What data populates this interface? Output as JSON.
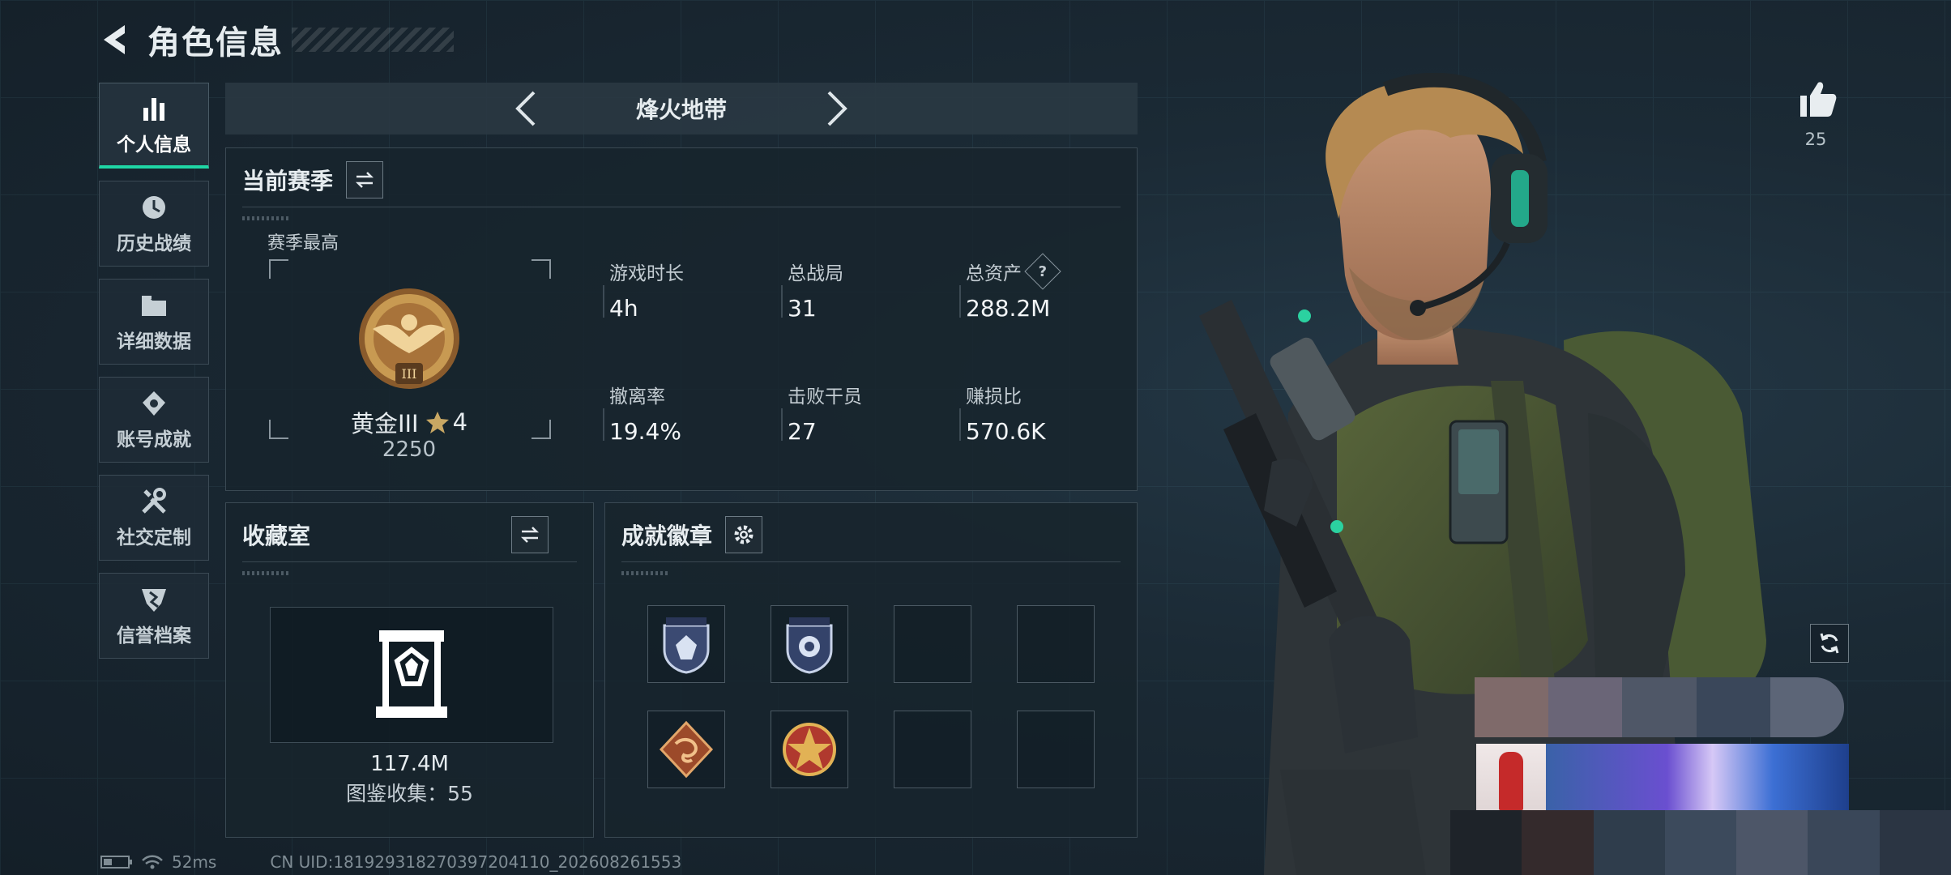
{
  "header": {
    "title": "角色信息"
  },
  "sidebar": {
    "items": [
      {
        "label": "个人信息",
        "icon": "bar-chart-icon",
        "active": true
      },
      {
        "label": "历史战绩",
        "icon": "history-icon",
        "active": false
      },
      {
        "label": "详细数据",
        "icon": "folder-icon",
        "active": false
      },
      {
        "label": "账号成就",
        "icon": "achievement-icon",
        "active": false
      },
      {
        "label": "社交定制",
        "icon": "tools-icon",
        "active": false
      },
      {
        "label": "信誉档案",
        "icon": "shield-icon",
        "active": false
      }
    ]
  },
  "mode_bar": {
    "name": "烽火地带"
  },
  "season": {
    "title": "当前赛季",
    "best_label": "赛季最高",
    "rank_name": "黄金III",
    "rank_stars": "4",
    "rank_score": "2250",
    "stats": [
      {
        "label": "游戏时长",
        "value": "4h"
      },
      {
        "label": "总战局",
        "value": "31"
      },
      {
        "label": "总资产",
        "value": "288.2M",
        "help": "?"
      },
      {
        "label": "撤离率",
        "value": "19.4%"
      },
      {
        "label": "击败干员",
        "value": "27"
      },
      {
        "label": "赚损比",
        "value": "570.6K"
      }
    ]
  },
  "collection": {
    "title": "收藏室",
    "value": "117.4M",
    "count_text": "图鉴收集：55"
  },
  "achievements": {
    "title": "成就徽章"
  },
  "likes": {
    "count": "25"
  },
  "status": {
    "ping": "52ms",
    "uid": "CN UID:181929318270397204110_202608261553"
  },
  "colors": {
    "accent": "#1fd6a5",
    "background": "#17232c",
    "gold": "#c89a52"
  }
}
